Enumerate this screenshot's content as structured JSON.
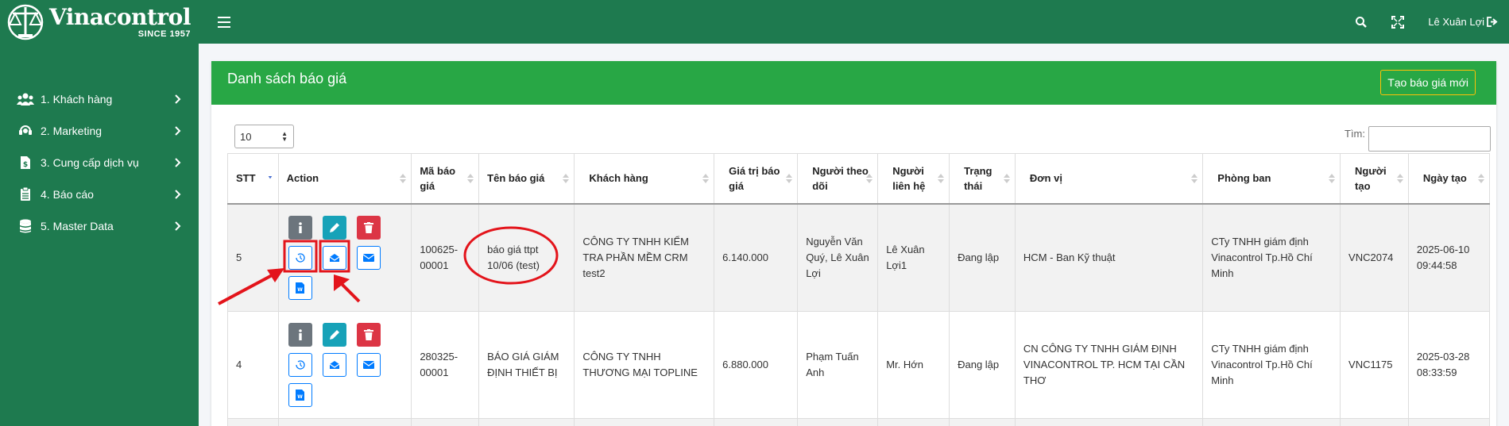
{
  "brand": {
    "name": "Vinacontrol",
    "since": "SINCE 1957"
  },
  "sidebar": {
    "items": [
      {
        "label": "1. Khách hàng",
        "icon": "users-icon"
      },
      {
        "label": "2. Marketing",
        "icon": "headset-icon"
      },
      {
        "label": "3. Cung cấp dịch vụ",
        "icon": "invoice-dollar-icon"
      },
      {
        "label": "4. Báo cáo",
        "icon": "clipboard-icon"
      },
      {
        "label": "5. Master Data",
        "icon": "database-icon"
      }
    ]
  },
  "topbar": {
    "user_name": "Lê Xuân Lợi"
  },
  "card": {
    "title": "Danh sách báo giá",
    "new_button": "Tạo báo giá mới"
  },
  "controls": {
    "page_size": "10",
    "search_label": "Tìm:"
  },
  "table": {
    "headers": [
      "STT",
      "Action",
      "Mã báo giá",
      "Tên báo giá",
      "Khách hàng",
      "Giá trị báo giá",
      "Người theo dõi",
      "Người liên hệ",
      "Trạng thái",
      "Đơn vị",
      "Phòng ban",
      "Người tạo",
      "Ngày tạo"
    ],
    "rows": [
      {
        "stt": "5",
        "ma": "100625-00001",
        "ten": "báo giá ttpt 10/06 (test)",
        "khach_hang": "CÔNG TY TNHH KIỂM TRA PHẦN MỀM CRM test2",
        "gia_tri": "6.140.000",
        "theo_doi": "Nguyễn Văn Quý, Lê Xuân Lợi",
        "lien_he": "Lê Xuân Lợi1",
        "trang_thai": "Đang lập",
        "don_vi": "HCM - Ban Kỹ thuật",
        "phong_ban": "CTy TNHH giám định Vinacontrol Tp.Hồ Chí Minh",
        "nguoi_tao": "VNC2074",
        "ngay_tao": "2025-06-10 09:44:58"
      },
      {
        "stt": "4",
        "ma": "280325-00001",
        "ten": "BÁO GIÁ GIÁM ĐỊNH THIẾT BỊ",
        "khach_hang": "CÔNG TY TNHH THƯƠNG MẠI TOPLINE",
        "gia_tri": "6.880.000",
        "theo_doi": "Phạm Tuấn Anh",
        "lien_he": "Mr. Hớn",
        "trang_thai": "Đang lập",
        "don_vi": "CN CÔNG TY TNHH GIÁM ĐỊNH VINACONTROL TP. HCM TẠI CẦN THƠ",
        "phong_ban": "CTy TNHH giám định Vinacontrol Tp.Hồ Chí Minh",
        "nguoi_tao": "VNC1175",
        "ngay_tao": "2025-03-28 08:33:59"
      }
    ]
  },
  "colors": {
    "sidebar": "#1e7a4f",
    "header": "#28a745",
    "annotation": "#e3141b"
  }
}
